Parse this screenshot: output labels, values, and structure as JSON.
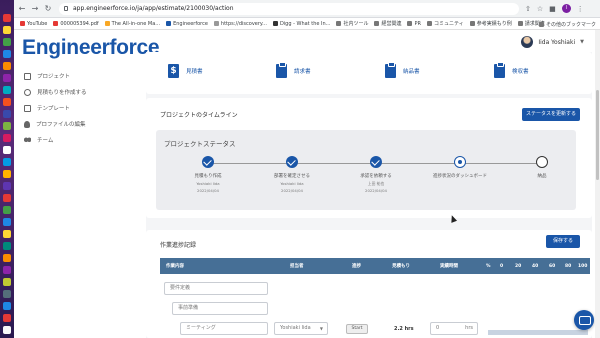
{
  "browser": {
    "url": "app.engineerforce.io/ja/app/estimate/2100030/action",
    "bookmarks": [
      "YouTube",
      "000005394.pdf",
      "The All-in-one Ma...",
      "Engineerforce",
      "https://discovery...",
      "Digg - What the In...",
      "社内ツール",
      "経営関連",
      "PR",
      "コミュニティ",
      "参考実績もり例",
      "請求関連"
    ],
    "bookmarks_right": "その他のブックマーク",
    "profile_initial": "I"
  },
  "app": {
    "logo": "Engineerforce",
    "user_name": "Iida Yoshiaki",
    "sidebar": [
      {
        "label": "プロジェクト",
        "icon": "folder-icon"
      },
      {
        "label": "見積もりを作成する",
        "icon": "plus-circle-icon"
      },
      {
        "label": "テンプレート",
        "icon": "template-icon"
      },
      {
        "label": "プロファイルの編集",
        "icon": "person-icon"
      },
      {
        "label": "チーム",
        "icon": "team-icon"
      }
    ],
    "documents": [
      {
        "label": "見積書",
        "icon": "dollar-doc-icon"
      },
      {
        "label": "請求書",
        "icon": "clipboard-icon"
      },
      {
        "label": "納品書",
        "icon": "clipboard-icon"
      },
      {
        "label": "検収書",
        "icon": "clipboard-icon"
      }
    ],
    "timeline": {
      "title": "プロジェクトのタイムライン",
      "update_button": "ステータスを更新する",
      "status_title": "プロジェクトステータス",
      "steps": [
        {
          "label": "見積もり作成",
          "person": "Yoshiaki Iida",
          "date": "2022/04/04",
          "state": "done"
        },
        {
          "label": "部署を確定させる",
          "person": "Yoshiaki Iida",
          "date": "2022/04/04",
          "state": "done"
        },
        {
          "label": "承認を依頼する",
          "person": "上田 祐也",
          "date": "2022/04/04",
          "state": "done"
        },
        {
          "label": "進捗状況のダッシュボード",
          "person": "",
          "date": "",
          "state": "current"
        },
        {
          "label": "納品",
          "person": "",
          "date": "",
          "state": "todo"
        }
      ]
    },
    "work": {
      "title": "作業進捗記録",
      "save_button": "保存する",
      "headers": [
        "作業内容",
        "担当者",
        "進捗",
        "見積もり",
        "実績時間",
        "%",
        "0",
        "20",
        "40",
        "60",
        "80",
        "100"
      ],
      "rows": {
        "l1": "要件定義",
        "l2": "事前準備",
        "l3": "ミーティング",
        "assignee": "Yoshiaki Iida",
        "start": "Start",
        "estimate": "2.2 hrs",
        "actual_value": "0",
        "actual_unit": "hrs"
      }
    }
  },
  "colors": {
    "brand": "#1a56a8",
    "header": "#466f96",
    "panel": "#f4f5f7"
  }
}
